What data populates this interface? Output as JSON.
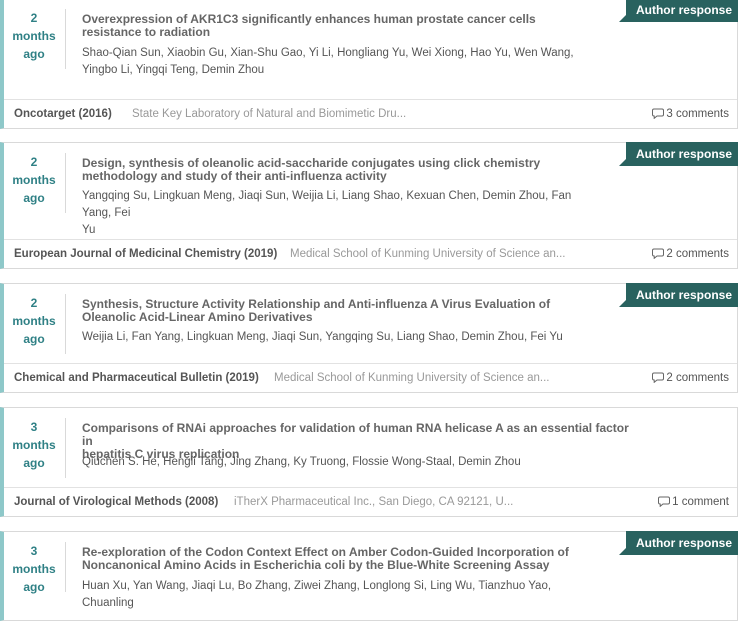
{
  "cards": [
    {
      "date_num": "2",
      "date_unit": "months",
      "date_suffix": "ago",
      "title_lines": [
        "Overexpression of AKR1C3 significantly enhances human prostate cancer cells",
        "resistance to radiation"
      ],
      "author_lines": [
        "Shao-Qian Sun, Xiaobin Gu, Xian-Shu Gao, Yi Li, Hongliang Yu, Wei Xiong, Hao Yu, Wen Wang,",
        "Yingbo Li, Yingqi Teng, Demin Zhou"
      ],
      "badge": "Author response",
      "journal": "Oncotarget (2016)",
      "affiliation": "State Key Laboratory of Natural and Biomimetic Dru...",
      "comments": "3 comments"
    },
    {
      "date_num": "2",
      "date_unit": "months",
      "date_suffix": "ago",
      "title_lines": [
        "Design, synthesis of oleanolic acid-saccharide conjugates using click chemistry",
        "methodology and study of their anti-influenza activity"
      ],
      "author_lines": [
        "Yangqing Su, Lingkuan Meng, Jiaqi Sun, Weijia Li, Liang Shao, Kexuan Chen, Demin Zhou, Fan Yang, Fei",
        "Yu"
      ],
      "badge": "Author response",
      "journal": "European Journal of Medicinal Chemistry (2019)",
      "affiliation": "Medical School of Kunming University of Science an...",
      "comments": "2 comments"
    },
    {
      "date_num": "2",
      "date_unit": "months",
      "date_suffix": "ago",
      "title_lines": [
        "Synthesis, Structure Activity Relationship and Anti-influenza A Virus Evaluation of",
        "Oleanolic Acid-Linear Amino Derivatives"
      ],
      "author_lines": [
        "Weijia Li, Fan Yang, Lingkuan Meng, Jiaqi Sun, Yangqing Su, Liang Shao, Demin Zhou, Fei Yu"
      ],
      "badge": "Author response",
      "journal": "Chemical and Pharmaceutical Bulletin (2019)",
      "affiliation": "Medical School of Kunming University of Science an...",
      "comments": "2 comments"
    },
    {
      "date_num": "3",
      "date_unit": "months",
      "date_suffix": "ago",
      "title_lines": [
        "Comparisons of RNAi approaches for validation of human RNA helicase A as an essential factor in",
        "hepatitis C virus replication"
      ],
      "author_lines": [
        "Qiuchen S. He, Hengli Tang, Jing Zhang, Ky Truong, Flossie Wong-Staal, Demin Zhou"
      ],
      "badge": "",
      "journal": "Journal of Virological Methods (2008)",
      "affiliation": "iTherX Pharmaceutical Inc., San Diego, CA 92121, U...",
      "comments": "1 comment"
    },
    {
      "date_num": "3",
      "date_unit": "months",
      "date_suffix": "ago",
      "title_lines": [
        "Re-exploration of the Codon Context Effect on Amber Codon-Guided Incorporation of",
        "Noncanonical Amino Acids in Escherichia coli by the Blue-White Screening Assay"
      ],
      "author_lines": [
        "Huan Xu, Yan Wang, Jiaqi Lu, Bo Zhang, Ziwei Zhang, Longlong Si, Ling Wu, Tianzhuo Yao, Chuanling"
      ],
      "badge": "Author response",
      "journal": "",
      "affiliation": "",
      "comments": ""
    }
  ],
  "colors": {
    "date_teal": "#2f8085",
    "badge_bg": "#29625f",
    "card_accent": "#8ec8c9"
  },
  "icons": {
    "comments": "speech-bubble-icon"
  }
}
